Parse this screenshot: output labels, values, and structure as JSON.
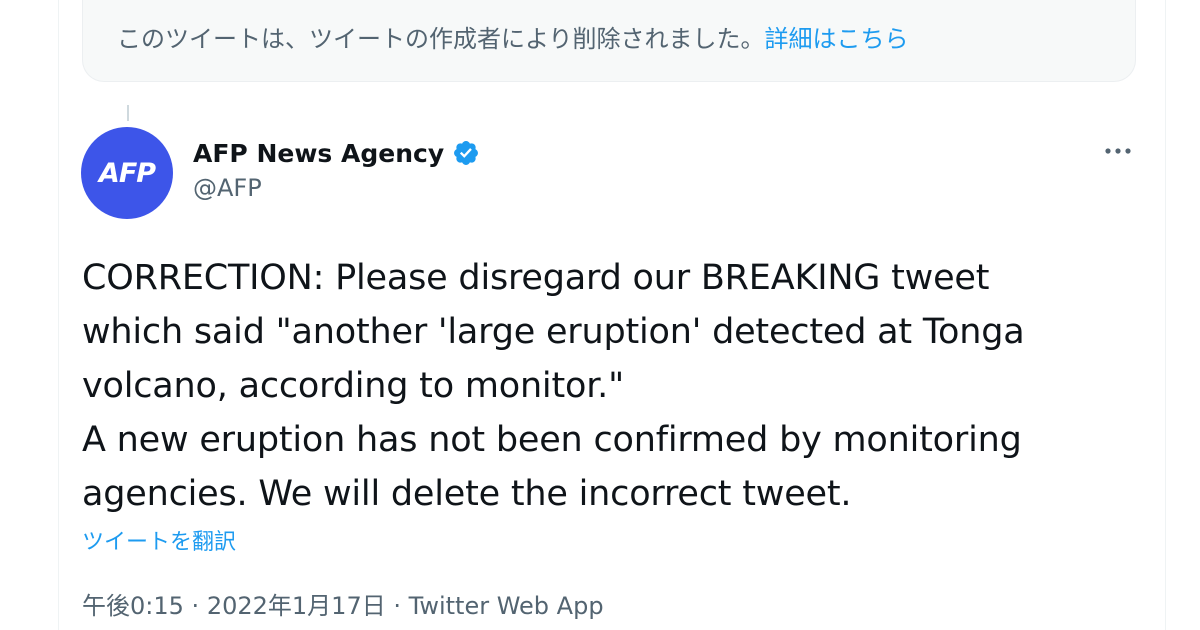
{
  "deleted_notice": {
    "text": "このツイートは、ツイートの作成者により削除されました。",
    "link_label": "詳細はこちら"
  },
  "tweet": {
    "avatar_text": "AFP",
    "avatar_color": "#3d55e9",
    "author_name": "AFP News Agency",
    "author_handle": "@AFP",
    "verified": true,
    "body": "CORRECTION: Please disregard our BREAKING tweet\nwhich said \"another 'large eruption' detected at Tonga\nvolcano, according to monitor.\"\nA new eruption has not been confirmed by monitoring\nagencies. We will delete the incorrect tweet.",
    "translate_label": "ツイートを翻訳",
    "time": "午後0:15",
    "date": "2022年1月17日",
    "separator": "·",
    "source": "Twitter Web App"
  },
  "icons": {
    "verified": "verified-badge-icon",
    "more": "more-options-icon"
  },
  "colors": {
    "accent": "#1d9bf0",
    "text_primary": "#0f1419",
    "text_secondary": "#536471"
  }
}
